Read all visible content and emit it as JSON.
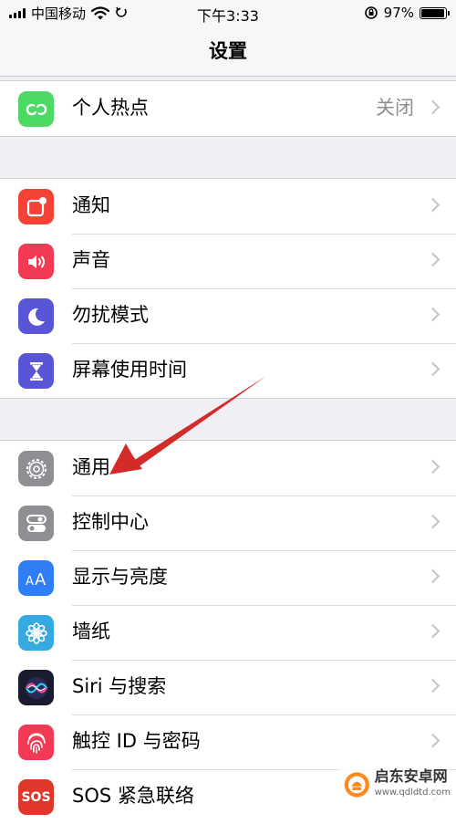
{
  "status_bar": {
    "carrier": "中国移动",
    "time": "下午3:33",
    "battery_percent": "97%",
    "battery_level": 0.97,
    "icons": [
      "signal-icon",
      "wifi-icon",
      "location-icon",
      "rotation-lock-icon",
      "battery-icon"
    ]
  },
  "nav": {
    "title": "设置"
  },
  "groups": [
    {
      "rows": [
        {
          "label": "个人热点",
          "value": "关闭",
          "icon": "hotspot-icon",
          "color": "#4cd964"
        }
      ]
    },
    {
      "rows": [
        {
          "label": "通知",
          "icon": "notifications-icon",
          "color": "#f44336"
        },
        {
          "label": "声音",
          "icon": "speaker-icon",
          "color": "#f23a55"
        },
        {
          "label": "勿扰模式",
          "icon": "moon-icon",
          "color": "#5856d6"
        },
        {
          "label": "屏幕使用时间",
          "icon": "hourglass-icon",
          "color": "#5856d6"
        }
      ]
    },
    {
      "rows": [
        {
          "label": "通用",
          "icon": "gear-icon",
          "color": "#8e8e93"
        },
        {
          "label": "控制中心",
          "icon": "toggles-icon",
          "color": "#8e8e93"
        },
        {
          "label": "显示与亮度",
          "icon": "text-size-icon",
          "color": "#2f7ef6"
        },
        {
          "label": "墙纸",
          "icon": "flower-icon",
          "color": "#36a9e0"
        },
        {
          "label": "Siri 与搜索",
          "icon": "siri-icon",
          "color": "#1b1b2f"
        },
        {
          "label": "触控 ID 与密码",
          "icon": "fingerprint-icon",
          "color": "#f23a55"
        },
        {
          "label": "SOS 紧急联络",
          "icon": "sos-icon",
          "color": "#e0362c",
          "icon_text": "SOS"
        }
      ]
    }
  ],
  "annotation": {
    "color": "#d42a2a"
  },
  "watermark": {
    "name": "启东安卓网",
    "url": "www.qdldtd.com"
  }
}
